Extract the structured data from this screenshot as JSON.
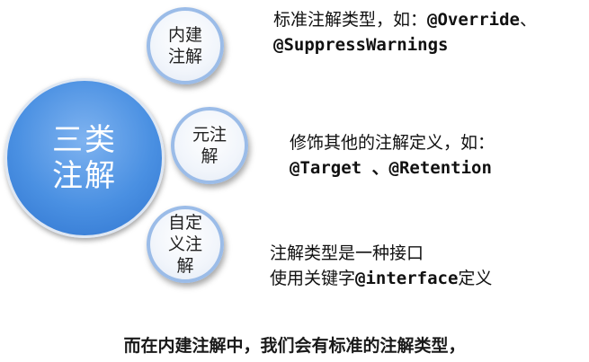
{
  "main_node": {
    "label": "三类\n注解"
  },
  "categories": [
    {
      "label": "内建\n注解",
      "desc_line1": "标准注解类型，如：",
      "desc_line1_code": "@Override",
      "desc_line1_tail": "、",
      "desc_line2_code": "@SuppressWarnings"
    },
    {
      "label": "元注\n解",
      "desc_line1": "修饰其他的注解定义，如：",
      "desc_line2_code": "@Target 、@Retention"
    },
    {
      "label": "自定\n义注\n解",
      "desc_line1": "注解类型是一种接口",
      "desc_line2_pre": "使用关键字",
      "desc_line2_code": "@interface",
      "desc_line2_post": "定义"
    }
  ],
  "caption": "而在内建注解中，我们会有标准的注解类型，",
  "colors": {
    "main_fill": "#4a90e2",
    "small_border": "#9bbce8"
  }
}
